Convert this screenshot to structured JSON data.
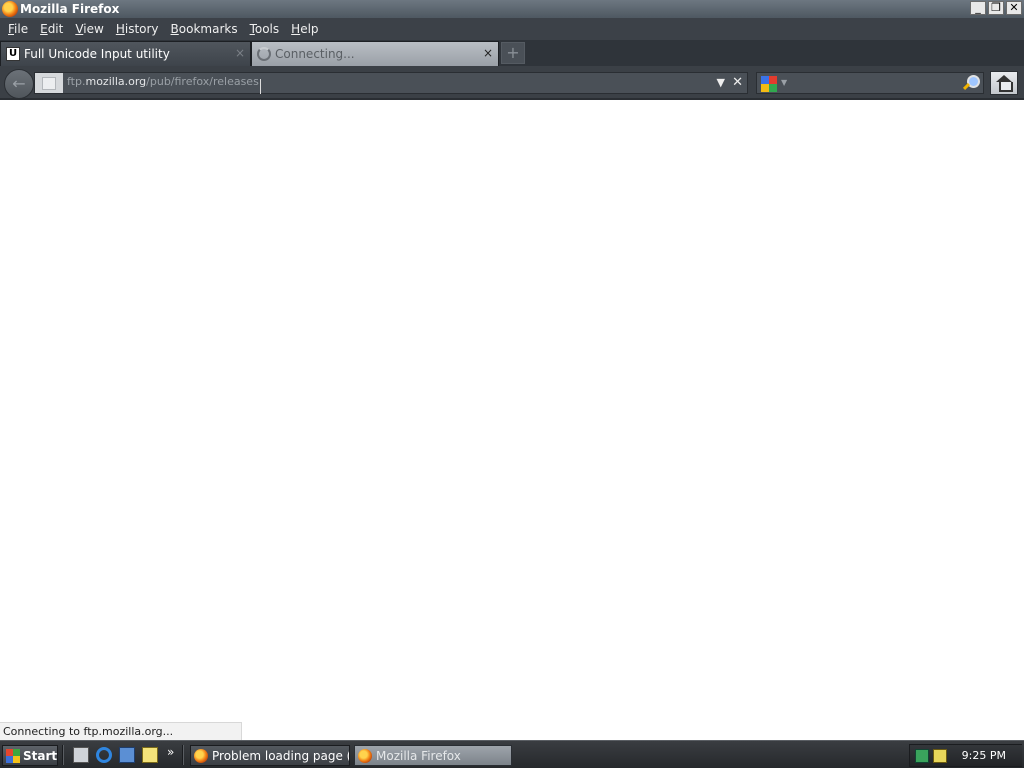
{
  "window": {
    "title": "Mozilla Firefox",
    "controls": {
      "minimize": "_",
      "maximize": "❐",
      "close": "✕"
    }
  },
  "menubar": {
    "items": [
      {
        "label": "File",
        "accel": "F",
        "rest": "ile"
      },
      {
        "label": "Edit",
        "accel": "E",
        "rest": "dit"
      },
      {
        "label": "View",
        "accel": "V",
        "rest": "iew"
      },
      {
        "label": "History",
        "accel": "H",
        "rest": "istory"
      },
      {
        "label": "Bookmarks",
        "accel": "B",
        "rest": "ookmarks"
      },
      {
        "label": "Tools",
        "accel": "T",
        "rest": "ools"
      },
      {
        "label": "Help",
        "accel": "H",
        "rest": "elp"
      }
    ]
  },
  "tabs": [
    {
      "label": "Full Unicode Input utility",
      "icon": "unicode-icon",
      "icon_glyph": "U",
      "close": "×"
    },
    {
      "label": "Connecting...",
      "icon": "loading-throbber-icon",
      "close": "×"
    }
  ],
  "newtab": {
    "glyph": "+"
  },
  "navbar": {
    "back_glyph": "←",
    "url": {
      "prefix": "ftp.",
      "host": "mozilla.org",
      "path": "/pub/firefox/releases"
    },
    "dropdown_glyph": "▼",
    "stop_glyph": "✕",
    "search": {
      "engine": "Google",
      "dropdown_glyph": "▼",
      "value": ""
    }
  },
  "status": {
    "text": "Connecting to ftp.mozilla.org..."
  },
  "taskbar": {
    "start_label": "Start",
    "quicklaunch_more": "»",
    "tasks": [
      {
        "label": "Problem loading page (K-...",
        "active": false
      },
      {
        "label": "Mozilla Firefox",
        "active": true
      }
    ],
    "clock": "9:25 PM"
  },
  "colors": {
    "chrome_dark": "#3b4046",
    "tab_active": "#b9bec4",
    "content_bg": "#ffffff"
  }
}
